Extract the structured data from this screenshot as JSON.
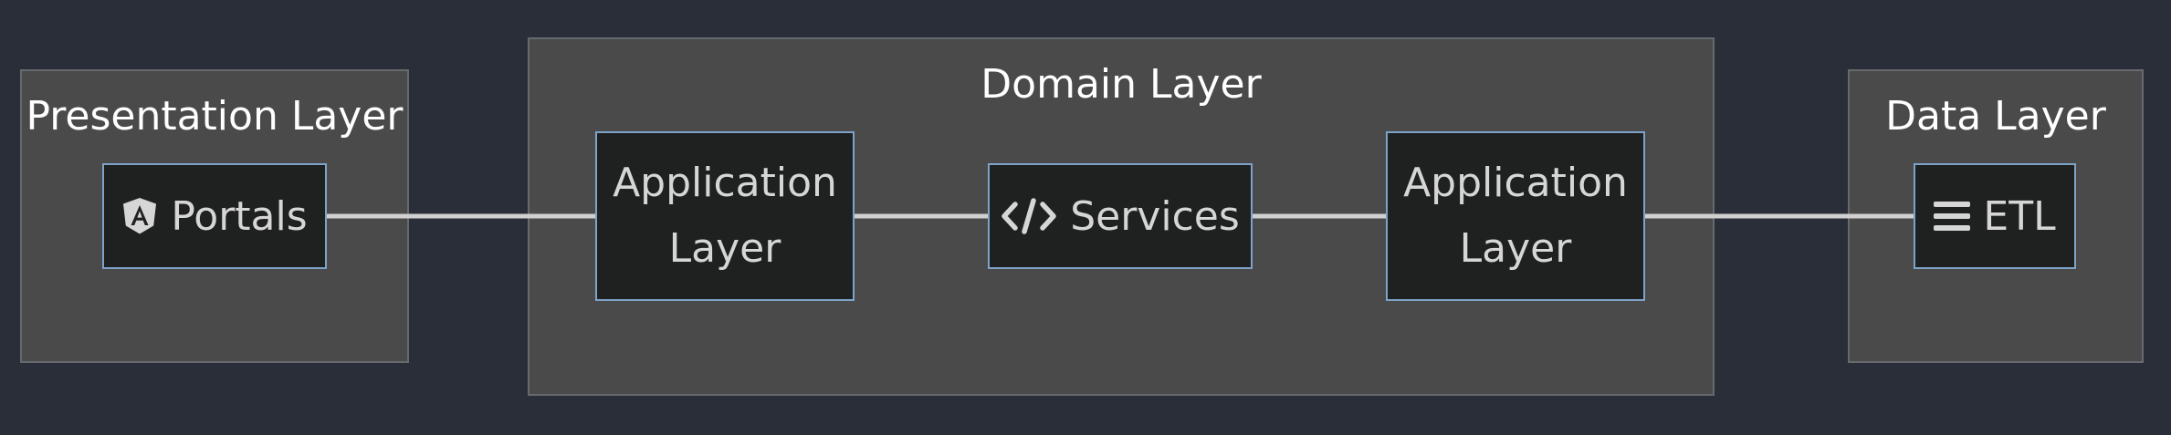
{
  "diagram": {
    "groups": {
      "presentation": {
        "title": "Presentation Layer"
      },
      "domain": {
        "title": "Domain Layer"
      },
      "data": {
        "title": "Data Layer"
      }
    },
    "nodes": {
      "portals": {
        "label": "Portals",
        "icon": "angular-icon"
      },
      "app_layer_left": {
        "line1": "Application",
        "line2": "Layer"
      },
      "services": {
        "label": "Services",
        "icon": "code-icon"
      },
      "app_layer_right": {
        "line1": "Application",
        "line2": "Layer"
      },
      "etl": {
        "label": "ETL",
        "icon": "bars-icon"
      }
    },
    "colors": {
      "background": "#2a2e38",
      "group_fill": "#4a4a4a",
      "group_border": "#666a6e",
      "node_fill": "#1f2020",
      "node_border": "#7ea3c8",
      "edge": "#d0d0d0",
      "title_text": "#ffffff",
      "node_text": "#d6d6d6"
    }
  }
}
